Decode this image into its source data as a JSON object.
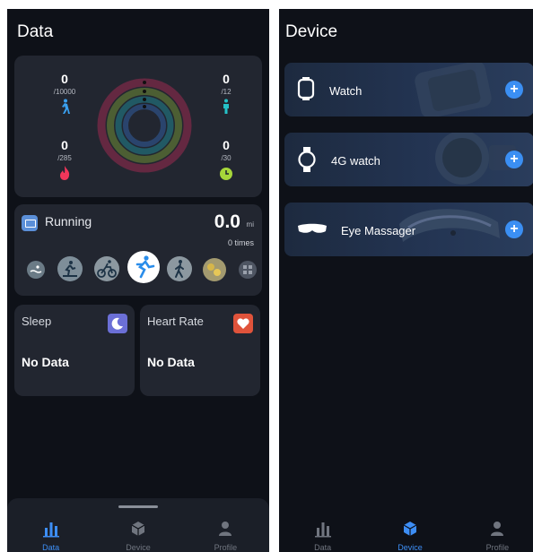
{
  "data_screen": {
    "title": "Data",
    "activity": {
      "steps": {
        "value": "0",
        "goal": "/10000",
        "icon": "walking-person-icon",
        "color": "#3aa0f0"
      },
      "stand": {
        "value": "0",
        "goal": "/12",
        "icon": "standing-person-icon",
        "color": "#25c2c8"
      },
      "calories": {
        "value": "0",
        "goal": "/285",
        "icon": "flame-icon",
        "color": "#f0365a"
      },
      "exercise": {
        "value": "0",
        "goal": "/30",
        "icon": "clock-icon",
        "color": "#a6d63a"
      },
      "rings": [
        "#e02d62",
        "#9ac93a",
        "#1fb9c5",
        "#3a7fe0"
      ]
    },
    "running": {
      "label": "Running",
      "value": "0.0",
      "unit": "mi",
      "times": "0 times",
      "sports": [
        "swimming-icon",
        "treadmill-icon",
        "cycling-icon",
        "running-icon",
        "walking-icon",
        "ball-games-icon",
        "more-icon"
      ]
    },
    "sleep": {
      "label": "Sleep",
      "value": "No Data",
      "badge_color": "#6b6fd6",
      "icon": "moon-icon"
    },
    "heart_rate": {
      "label": "Heart Rate",
      "value": "No Data",
      "badge_color": "#e0533b",
      "icon": "heart-icon"
    }
  },
  "device_screen": {
    "title": "Device",
    "devices": [
      {
        "name": "Watch",
        "icon": "watch-square-icon"
      },
      {
        "name": "4G watch",
        "icon": "watch-round-icon"
      },
      {
        "name": "Eye Massager",
        "icon": "eye-mask-icon"
      }
    ],
    "add_label": "+"
  },
  "tabs": [
    {
      "label": "Data",
      "icon": "bar-chart-icon"
    },
    {
      "label": "Device",
      "icon": "cube-icon"
    },
    {
      "label": "Profile",
      "icon": "person-icon"
    }
  ],
  "accent": "#3d8ef5"
}
